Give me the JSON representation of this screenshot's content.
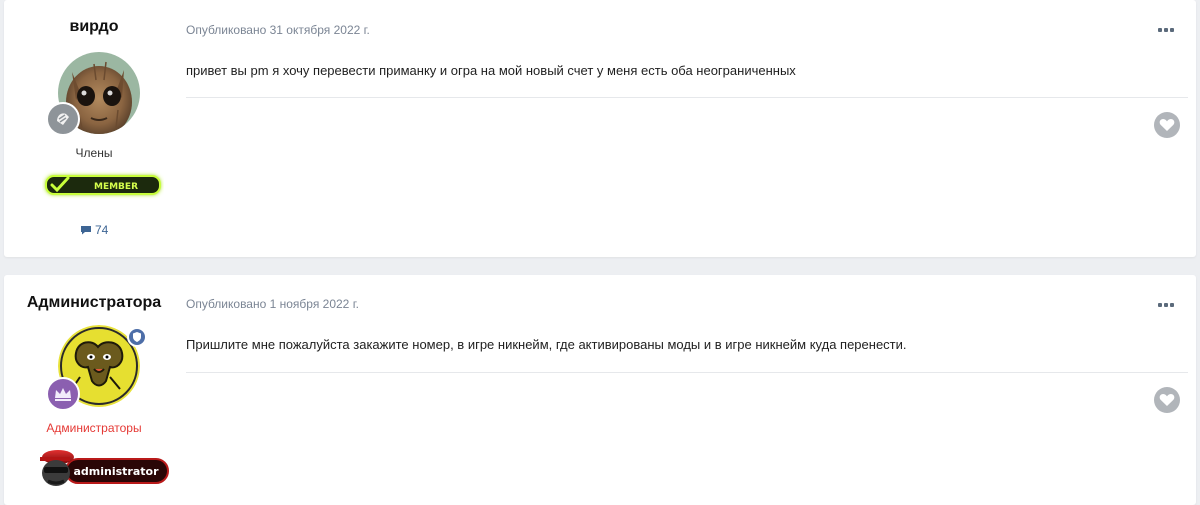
{
  "posts": [
    {
      "author": "вирдо",
      "date_text": "Опубликовано 31 октября 2022 г.",
      "content": "привет вы pm я хочу перевести приманку и огра на мой новый счет у меня есть оба неограниченных",
      "group": "Члены",
      "group_color": "#333333",
      "badge_label": "MEMBER",
      "post_count": "74"
    },
    {
      "author": "Администратора",
      "date_text": "Опубликовано 1 ноября 2022 г.",
      "content": "Пришлите мне пожалуйста закажите номер, в игре никнейм, где активированы моды и в игре никнейм куда перенести.",
      "group": "Администраторы",
      "group_color": "#e53935",
      "badge_label": "administrator"
    }
  ],
  "colors": {
    "page_bg": "#edeff2",
    "meta_text": "#7b8594",
    "like_button": "#b1b5ba",
    "post_count_icon": "#3d6594"
  },
  "icons": {
    "more": "more-options-icon",
    "like": "heart-icon",
    "comment": "comment-icon",
    "rank1": "rank-badge-icon",
    "rank2": "crown-icon",
    "moderator": "shield-icon"
  }
}
